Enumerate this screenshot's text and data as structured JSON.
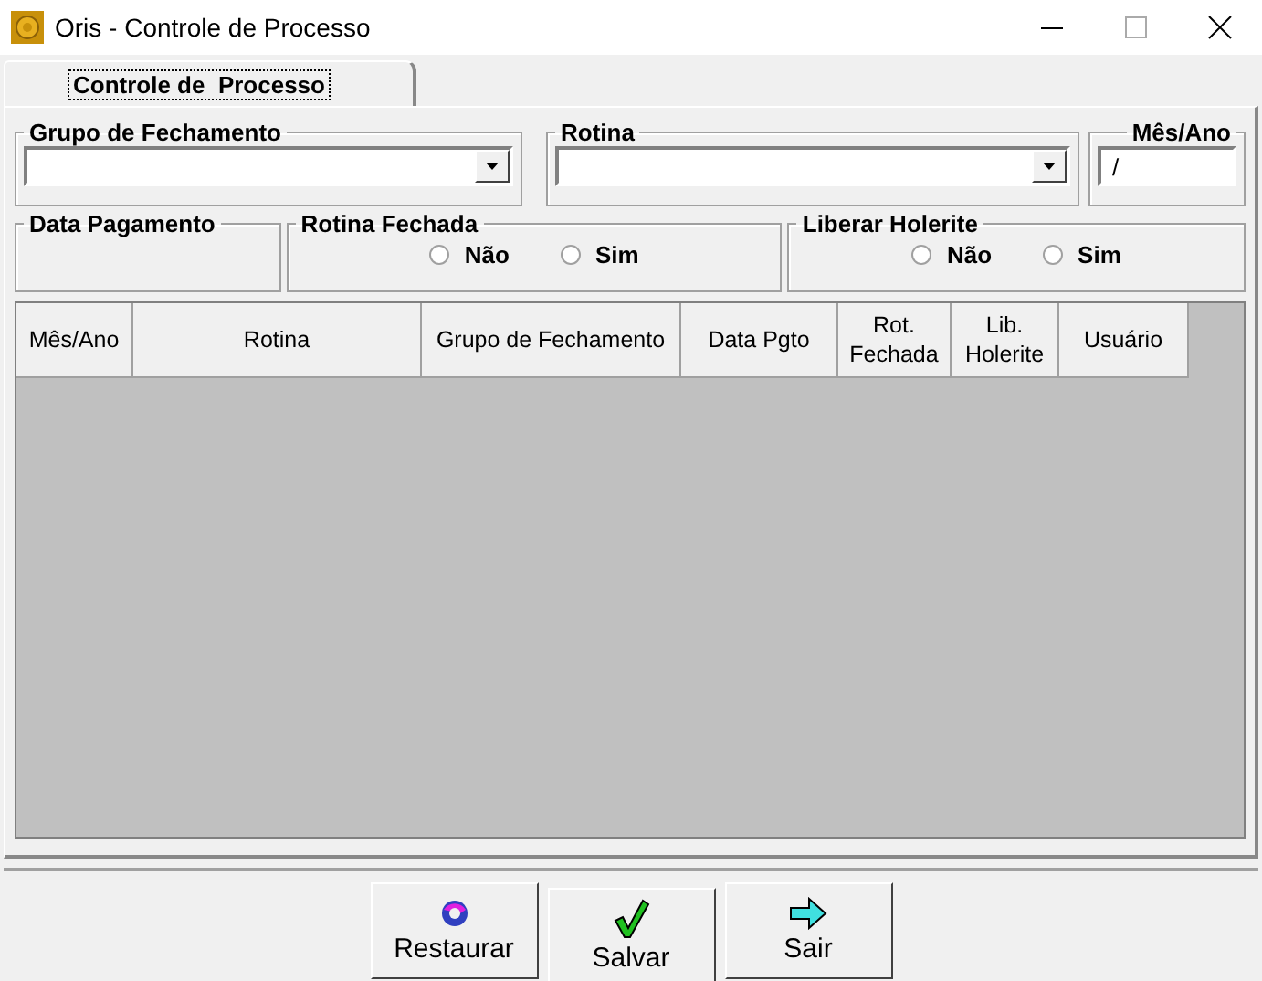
{
  "window": {
    "title": "Oris - Controle de Processo"
  },
  "tabs": [
    {
      "label": "Controle de  Processo",
      "selected": true
    }
  ],
  "grupo_fechamento": {
    "label": "Grupo de Fechamento"
  },
  "rotina": {
    "label": "Rotina"
  },
  "mes_ano": {
    "label": "Mês/Ano",
    "value": "/"
  },
  "data_pagamento": {
    "label": "Data Pagamento"
  },
  "rotina_fechada": {
    "label": "Rotina Fechada",
    "options": [
      {
        "label": "Não",
        "selected": false
      },
      {
        "label": "Sim",
        "selected": false
      }
    ]
  },
  "liberar_holerite": {
    "label": "Liberar Holerite",
    "options": [
      {
        "label": "Não",
        "selected": false
      },
      {
        "label": "Sim",
        "selected": false
      }
    ]
  },
  "table": {
    "columns": [
      "Mês/Ano",
      "Rotina",
      "Grupo de Fechamento",
      "Data Pgto",
      "Rot.\nFechada",
      "Lib.\nHolerite",
      "Usuário"
    ]
  },
  "buttons": [
    {
      "kind": "restore",
      "label": "Restaurar"
    },
    {
      "kind": "save",
      "label": "Salvar"
    },
    {
      "kind": "exit",
      "label": "Sair"
    }
  ]
}
